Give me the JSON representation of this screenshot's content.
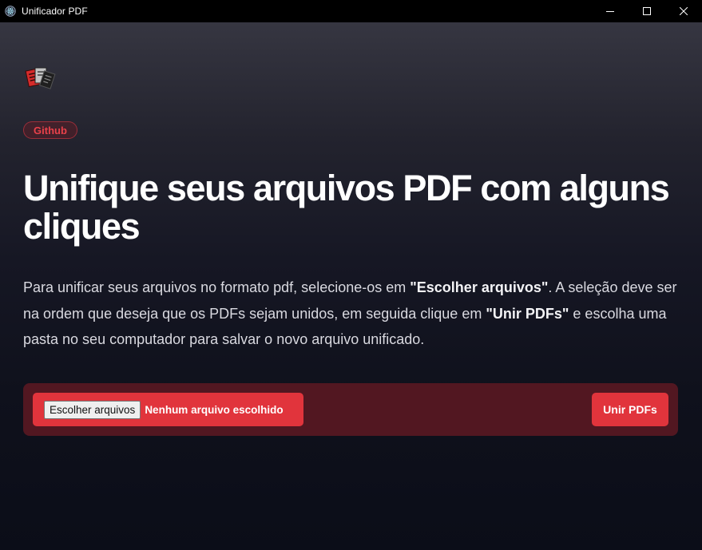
{
  "window": {
    "title": "Unificador PDF",
    "controls": [
      "minimize-icon",
      "maximize-icon",
      "close-icon"
    ]
  },
  "header": {
    "logo_icon": "pdf-files-icon",
    "badge_label": "Github"
  },
  "main": {
    "headline": "Unifique seus arquivos PDF com alguns cliques",
    "description": {
      "part1": "Para unificar seus arquivos no formato pdf, selecione-os em ",
      "bold1": "\"Escolher arquivos\"",
      "part2": ". A seleção deve ser na ordem que deseja que os PDFs sejam unidos, em seguida clique em ",
      "bold2": "\"Unir PDFs\"",
      "part3": " e escolha uma pasta no seu computador para salvar o novo arquivo unificado."
    }
  },
  "actions": {
    "file_button_label": "Escolher arquivos",
    "file_status": "Nenhum arquivo escolhido",
    "merge_button_label": "Unir PDFs"
  },
  "colors": {
    "accent": "#e1343c",
    "action_bar_bg": "#521721",
    "titlebar_bg": "#000000"
  }
}
